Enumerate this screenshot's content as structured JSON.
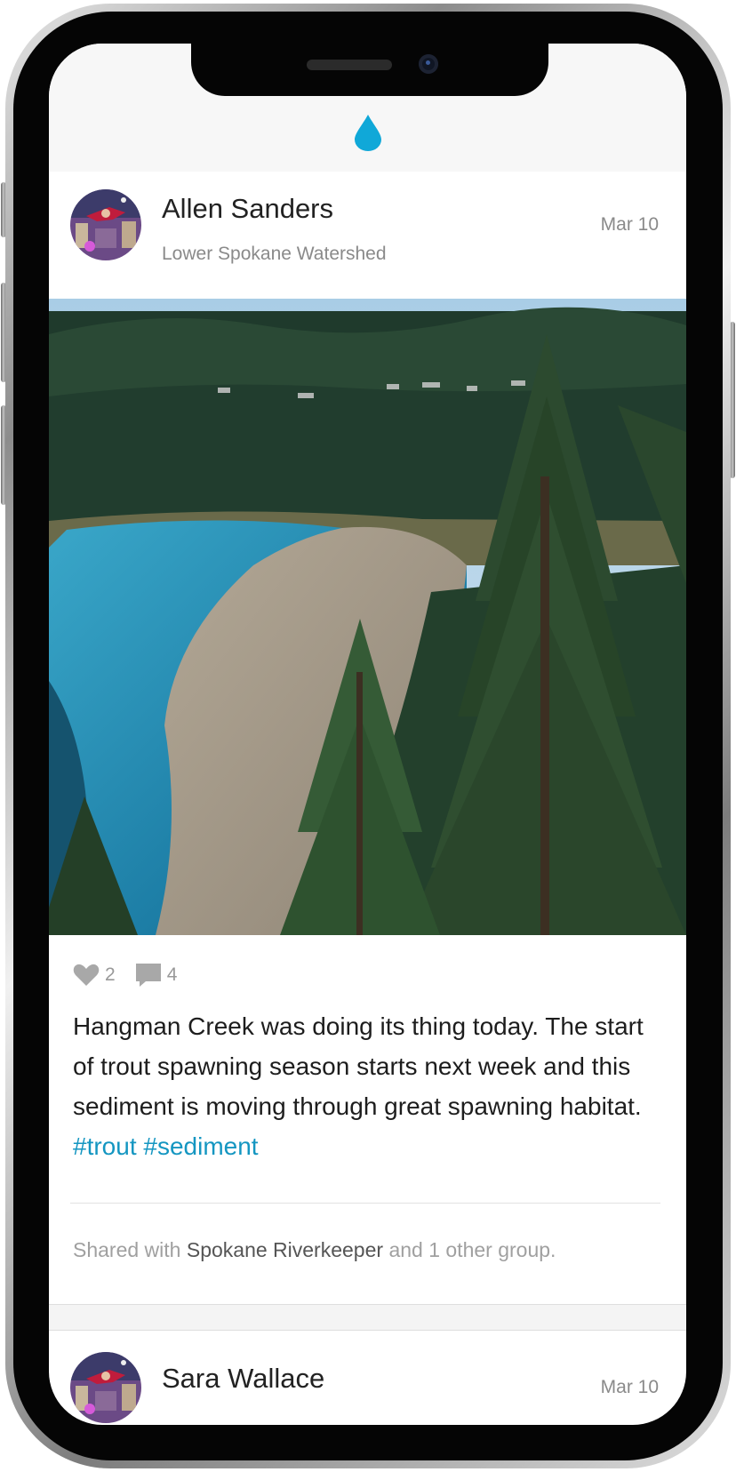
{
  "app": {
    "logo_icon": "water-drop-icon",
    "accent_color": "#10a8d8"
  },
  "feed": {
    "posts": [
      {
        "author": "Allen Sanders",
        "group": "Lower Spokane Watershed",
        "date": "Mar 10",
        "likes": "2",
        "comments": "4",
        "caption_text": "Hangman Creek was doing its thing today. The start of trout spawning season starts next week and this sediment is moving through great spawning habitat.",
        "hashtags": "#trout #sediment",
        "shared_prefix": "Shared with",
        "shared_group": "Spokane Riverkeeper",
        "shared_suffix": "and 1 other group."
      },
      {
        "author": "Sara Wallace",
        "date": "Mar 10"
      }
    ]
  }
}
